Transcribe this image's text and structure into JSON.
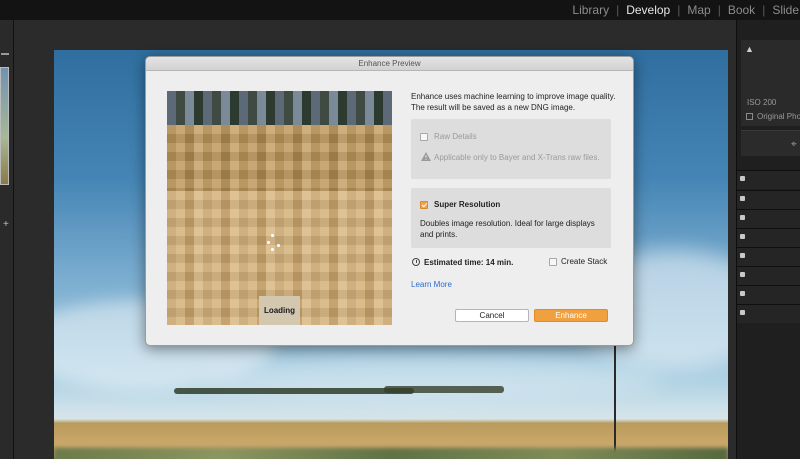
{
  "modules": [
    "Library",
    "Develop",
    "Map",
    "Book",
    "Slide"
  ],
  "active_module": "Develop",
  "right_panel": {
    "iso": "ISO 200",
    "original_photo_label": "Original Photo"
  },
  "dialog": {
    "title": "Enhance Preview",
    "loading_label": "Loading",
    "description": "Enhance uses machine learning to improve image quality. The result will be saved as a new DNG image.",
    "raw_details": {
      "label": "Raw Details",
      "checked": false,
      "note": "Applicable only to Bayer and X-Trans raw files."
    },
    "super_resolution": {
      "label": "Super Resolution",
      "checked": true,
      "note": "Doubles image resolution. Ideal for large displays and prints."
    },
    "estimated_time": "Estimated time: 14 min.",
    "create_stack_label": "Create Stack",
    "learn_more": "Learn More",
    "cancel_label": "Cancel",
    "enhance_label": "Enhance"
  },
  "colors": {
    "accent": "#f1a040",
    "link": "#2d6cd0"
  }
}
